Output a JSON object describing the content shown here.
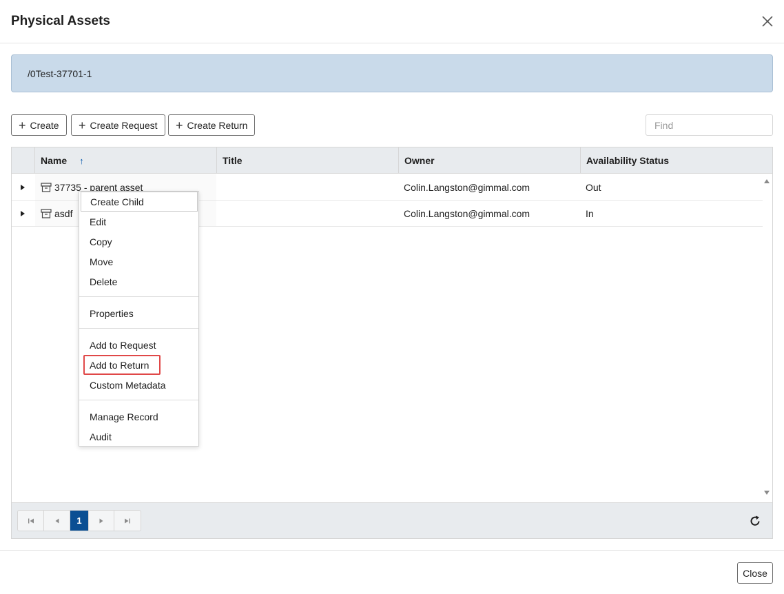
{
  "dialog": {
    "title": "Physical Assets",
    "close_icon": "close-icon"
  },
  "path": {
    "text": "/0Test-37701-1"
  },
  "toolbar": {
    "create_label": "Create",
    "create_request_label": "Create Request",
    "create_return_label": "Create Return",
    "find_placeholder": "Find"
  },
  "grid": {
    "columns": [
      {
        "label": "Name",
        "sort": "ascending"
      },
      {
        "label": "Title"
      },
      {
        "label": "Owner"
      },
      {
        "label": "Availability Status"
      }
    ],
    "rows": [
      {
        "name": "37735 - parent asset",
        "title": "",
        "owner": "Colin.Langston@gimmal.com",
        "status": "Out",
        "icon": "archive-box-icon"
      },
      {
        "name": "asdf",
        "title": "",
        "owner": "Colin.Langston@gimmal.com",
        "status": "In",
        "icon": "archive-box-icon"
      }
    ],
    "pager": {
      "current_page": "1"
    }
  },
  "context_menu": {
    "groups": [
      [
        "Create Child",
        "Edit",
        "Copy",
        "Move",
        "Delete"
      ],
      [
        "Properties"
      ],
      [
        "Add to Request",
        "Add to Return",
        "Custom Metadata"
      ],
      [
        "Manage Record",
        "Audit"
      ]
    ],
    "items": {
      "create_child": "Create Child",
      "edit": "Edit",
      "copy": "Copy",
      "move": "Move",
      "delete": "Delete",
      "properties": "Properties",
      "add_to_request": "Add to Request",
      "add_to_return": "Add to Return",
      "custom_metadata": "Custom Metadata",
      "manage_record": "Manage Record",
      "audit": "Audit"
    },
    "highlighted_item": "Add to Return"
  },
  "footer": {
    "close_label": "Close"
  },
  "colors": {
    "path_bar_bg": "#c9daea",
    "accent": "#0b4f93",
    "highlight_border": "#e04848",
    "header_bg": "#e8ebee"
  }
}
